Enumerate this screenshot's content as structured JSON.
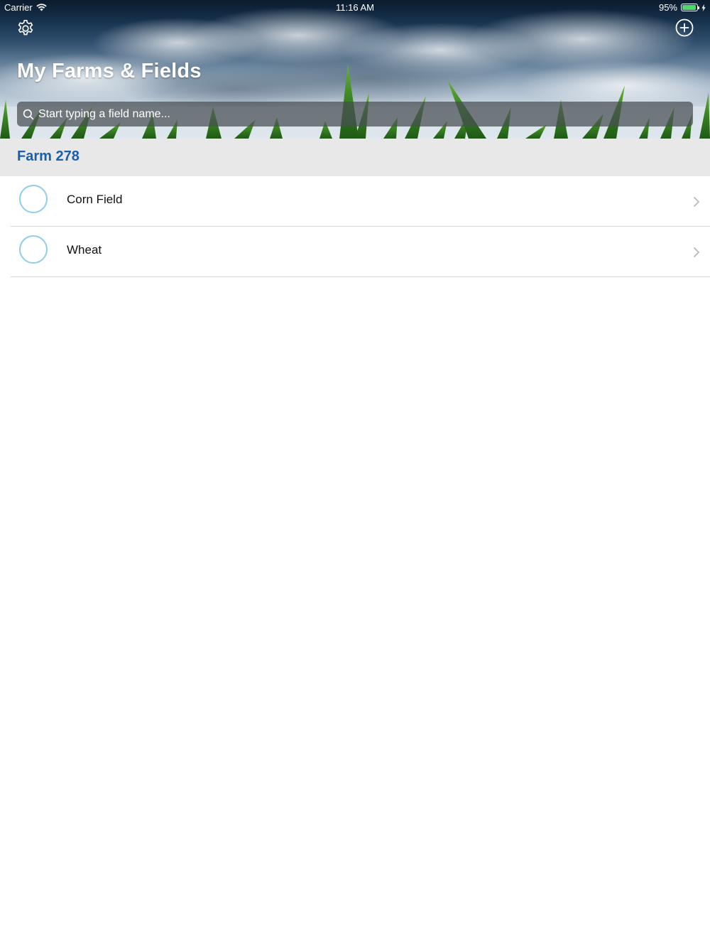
{
  "status_bar": {
    "carrier": "Carrier",
    "time": "11:16 AM",
    "battery_text": "95%",
    "battery_level": 0.95,
    "battery_color": "#4cd964"
  },
  "header": {
    "title": "My Farms & Fields",
    "settings_icon": "gear-icon",
    "add_icon": "plus-circle-icon"
  },
  "search": {
    "placeholder": "Start typing a field name...",
    "value": ""
  },
  "farm": {
    "name": "Farm 278",
    "accent_color": "#1b5fa8"
  },
  "fields": [
    {
      "name": "Corn Field"
    },
    {
      "name": "Wheat"
    }
  ]
}
